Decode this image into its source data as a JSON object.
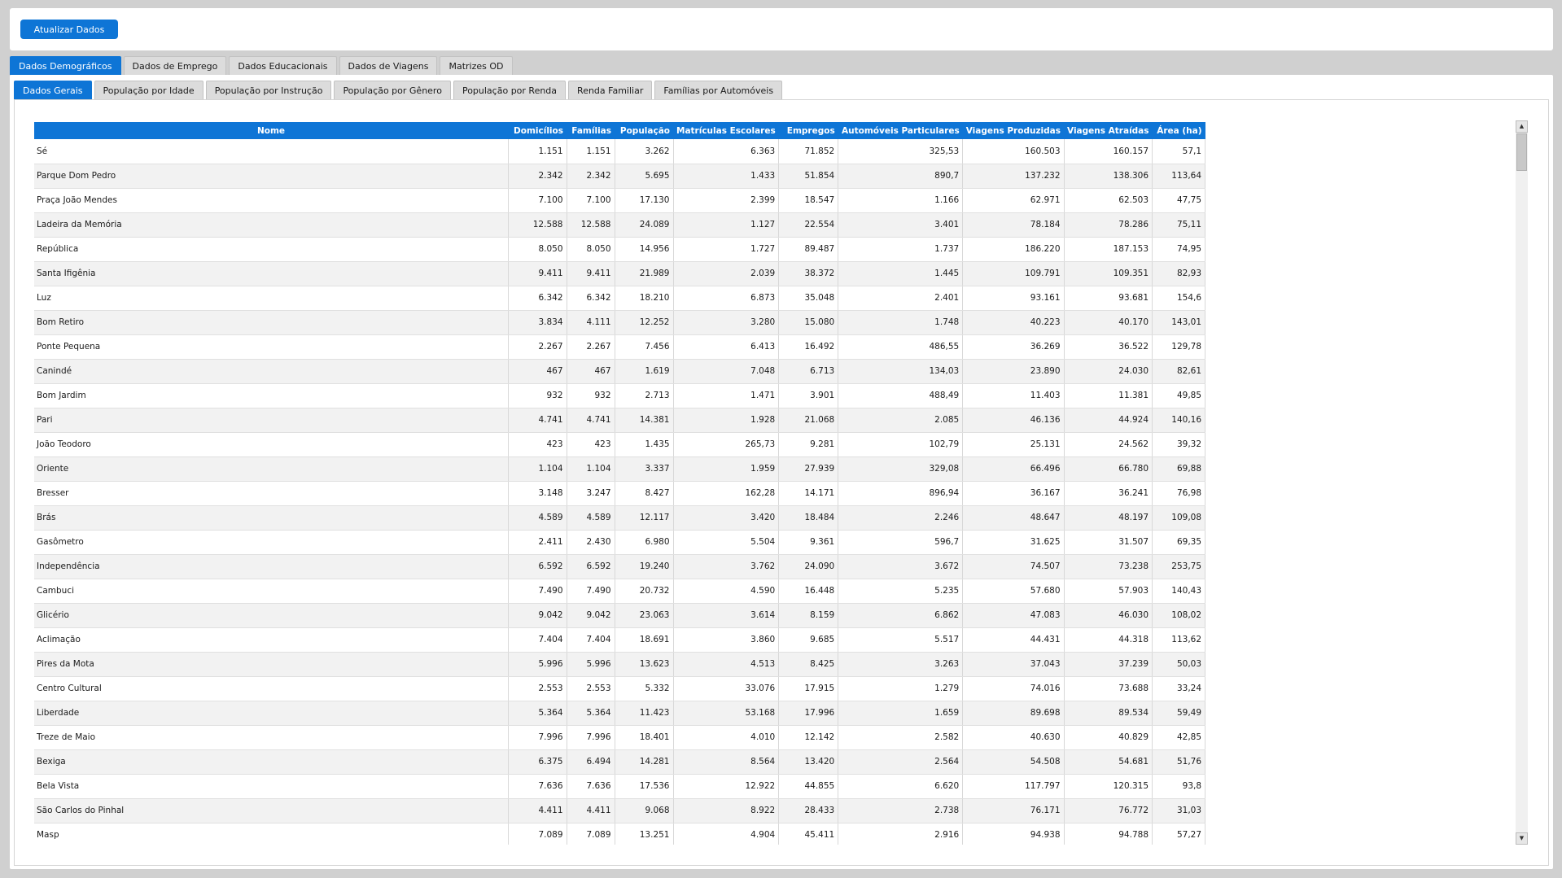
{
  "toolbar": {
    "update_label": "Atualizar Dados"
  },
  "main_tabs": [
    {
      "label": "Dados Demográficos",
      "active": true
    },
    {
      "label": "Dados de Emprego",
      "active": false
    },
    {
      "label": "Dados Educacionais",
      "active": false
    },
    {
      "label": "Dados de Viagens",
      "active": false
    },
    {
      "label": "Matrizes OD",
      "active": false
    }
  ],
  "sub_tabs": [
    {
      "label": "Dados Gerais",
      "active": true
    },
    {
      "label": "População por Idade",
      "active": false
    },
    {
      "label": "População por Instrução",
      "active": false
    },
    {
      "label": "População por Gênero",
      "active": false
    },
    {
      "label": "População por Renda",
      "active": false
    },
    {
      "label": "Renda Familiar",
      "active": false
    },
    {
      "label": "Famílias por Automóveis",
      "active": false
    }
  ],
  "table": {
    "columns": [
      "Nome",
      "Domicílios",
      "Famílias",
      "População",
      "Matrículas Escolares",
      "Empregos",
      "Automóveis Particulares",
      "Viagens Produzidas",
      "Viagens Atraídas",
      "Área (ha)"
    ],
    "rows": [
      [
        "Sé",
        "1.151",
        "1.151",
        "3.262",
        "6.363",
        "71.852",
        "325,53",
        "160.503",
        "160.157",
        "57,1"
      ],
      [
        "Parque Dom Pedro",
        "2.342",
        "2.342",
        "5.695",
        "1.433",
        "51.854",
        "890,7",
        "137.232",
        "138.306",
        "113,64"
      ],
      [
        "Praça João Mendes",
        "7.100",
        "7.100",
        "17.130",
        "2.399",
        "18.547",
        "1.166",
        "62.971",
        "62.503",
        "47,75"
      ],
      [
        "Ladeira da Memória",
        "12.588",
        "12.588",
        "24.089",
        "1.127",
        "22.554",
        "3.401",
        "78.184",
        "78.286",
        "75,11"
      ],
      [
        "República",
        "8.050",
        "8.050",
        "14.956",
        "1.727",
        "89.487",
        "1.737",
        "186.220",
        "187.153",
        "74,95"
      ],
      [
        "Santa Ifigênia",
        "9.411",
        "9.411",
        "21.989",
        "2.039",
        "38.372",
        "1.445",
        "109.791",
        "109.351",
        "82,93"
      ],
      [
        "Luz",
        "6.342",
        "6.342",
        "18.210",
        "6.873",
        "35.048",
        "2.401",
        "93.161",
        "93.681",
        "154,6"
      ],
      [
        "Bom Retiro",
        "3.834",
        "4.111",
        "12.252",
        "3.280",
        "15.080",
        "1.748",
        "40.223",
        "40.170",
        "143,01"
      ],
      [
        "Ponte Pequena",
        "2.267",
        "2.267",
        "7.456",
        "6.413",
        "16.492",
        "486,55",
        "36.269",
        "36.522",
        "129,78"
      ],
      [
        "Canindé",
        "467",
        "467",
        "1.619",
        "7.048",
        "6.713",
        "134,03",
        "23.890",
        "24.030",
        "82,61"
      ],
      [
        "Bom Jardim",
        "932",
        "932",
        "2.713",
        "1.471",
        "3.901",
        "488,49",
        "11.403",
        "11.381",
        "49,85"
      ],
      [
        "Pari",
        "4.741",
        "4.741",
        "14.381",
        "1.928",
        "21.068",
        "2.085",
        "46.136",
        "44.924",
        "140,16"
      ],
      [
        "João Teodoro",
        "423",
        "423",
        "1.435",
        "265,73",
        "9.281",
        "102,79",
        "25.131",
        "24.562",
        "39,32"
      ],
      [
        "Oriente",
        "1.104",
        "1.104",
        "3.337",
        "1.959",
        "27.939",
        "329,08",
        "66.496",
        "66.780",
        "69,88"
      ],
      [
        "Bresser",
        "3.148",
        "3.247",
        "8.427",
        "162,28",
        "14.171",
        "896,94",
        "36.167",
        "36.241",
        "76,98"
      ],
      [
        "Brás",
        "4.589",
        "4.589",
        "12.117",
        "3.420",
        "18.484",
        "2.246",
        "48.647",
        "48.197",
        "109,08"
      ],
      [
        "Gasômetro",
        "2.411",
        "2.430",
        "6.980",
        "5.504",
        "9.361",
        "596,7",
        "31.625",
        "31.507",
        "69,35"
      ],
      [
        "Independência",
        "6.592",
        "6.592",
        "19.240",
        "3.762",
        "24.090",
        "3.672",
        "74.507",
        "73.238",
        "253,75"
      ],
      [
        "Cambuci",
        "7.490",
        "7.490",
        "20.732",
        "4.590",
        "16.448",
        "5.235",
        "57.680",
        "57.903",
        "140,43"
      ],
      [
        "Glicério",
        "9.042",
        "9.042",
        "23.063",
        "3.614",
        "8.159",
        "6.862",
        "47.083",
        "46.030",
        "108,02"
      ],
      [
        "Aclimação",
        "7.404",
        "7.404",
        "18.691",
        "3.860",
        "9.685",
        "5.517",
        "44.431",
        "44.318",
        "113,62"
      ],
      [
        "Pires da Mota",
        "5.996",
        "5.996",
        "13.623",
        "4.513",
        "8.425",
        "3.263",
        "37.043",
        "37.239",
        "50,03"
      ],
      [
        "Centro Cultural",
        "2.553",
        "2.553",
        "5.332",
        "33.076",
        "17.915",
        "1.279",
        "74.016",
        "73.688",
        "33,24"
      ],
      [
        "Liberdade",
        "5.364",
        "5.364",
        "11.423",
        "53.168",
        "17.996",
        "1.659",
        "89.698",
        "89.534",
        "59,49"
      ],
      [
        "Treze de Maio",
        "7.996",
        "7.996",
        "18.401",
        "4.010",
        "12.142",
        "2.582",
        "40.630",
        "40.829",
        "42,85"
      ],
      [
        "Bexiga",
        "6.375",
        "6.494",
        "14.281",
        "8.564",
        "13.420",
        "2.564",
        "54.508",
        "54.681",
        "51,76"
      ],
      [
        "Bela Vista",
        "7.636",
        "7.636",
        "17.536",
        "12.922",
        "44.855",
        "6.620",
        "117.797",
        "120.315",
        "93,8"
      ],
      [
        "São Carlos do Pinhal",
        "4.411",
        "4.411",
        "9.068",
        "8.922",
        "28.433",
        "2.738",
        "76.171",
        "76.772",
        "31,03"
      ],
      [
        "Masp",
        "7.089",
        "7.089",
        "13.251",
        "4.904",
        "45.411",
        "2.916",
        "94.938",
        "94.788",
        "57,27"
      ]
    ]
  },
  "scrollbar": {
    "up_icon": "arrow-up",
    "down_icon": "arrow-down"
  },
  "colors": {
    "accent": "#0e75d6",
    "background": "#d0d0d0"
  }
}
